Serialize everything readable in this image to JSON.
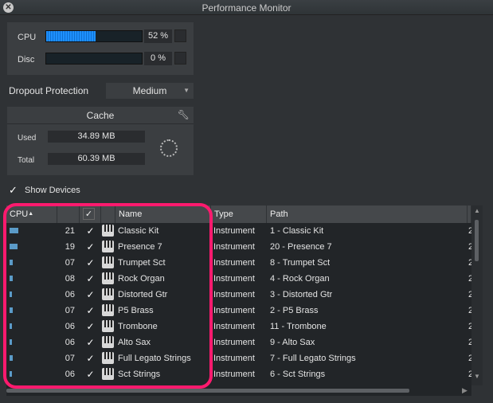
{
  "window": {
    "title": "Performance Monitor"
  },
  "meters": {
    "cpu_label": "CPU",
    "cpu_value": "52 %",
    "cpu_level": 0.52,
    "disc_label": "Disc",
    "disc_value": "0 %",
    "disc_level": 0
  },
  "dropout": {
    "label": "Dropout Protection",
    "value": "Medium"
  },
  "cache": {
    "title": "Cache",
    "used_label": "Used",
    "used_value": "34.89 MB",
    "total_label": "Total",
    "total_value": "60.39 MB"
  },
  "show_devices": {
    "label": "Show Devices",
    "checked": true
  },
  "table": {
    "headers": {
      "cpu": "CPU",
      "name": "Name",
      "type": "Type",
      "path": "Path"
    },
    "rows": [
      {
        "cpu": "21",
        "name": "Classic Kit",
        "type": "Instrument",
        "path": "1 - Classic Kit",
        "extra": "2"
      },
      {
        "cpu": "19",
        "name": "Presence 7",
        "type": "Instrument",
        "path": "20 - Presence 7",
        "extra": "2"
      },
      {
        "cpu": "07",
        "name": "Trumpet Sct",
        "type": "Instrument",
        "path": "8 - Trumpet Sct",
        "extra": "2"
      },
      {
        "cpu": "08",
        "name": "Rock Organ",
        "type": "Instrument",
        "path": "4 - Rock Organ",
        "extra": "2"
      },
      {
        "cpu": "06",
        "name": "Distorted Gtr",
        "type": "Instrument",
        "path": "3 - Distorted Gtr",
        "extra": "2"
      },
      {
        "cpu": "07",
        "name": "P5 Brass",
        "type": "Instrument",
        "path": "2 - P5 Brass",
        "extra": "2"
      },
      {
        "cpu": "06",
        "name": "Trombone",
        "type": "Instrument",
        "path": "11 - Trombone",
        "extra": "2"
      },
      {
        "cpu": "06",
        "name": "Alto Sax",
        "type": "Instrument",
        "path": "9 - Alto Sax",
        "extra": "2"
      },
      {
        "cpu": "07",
        "name": "Full Legato Strings",
        "type": "Instrument",
        "path": "7 - Full Legato Strings",
        "extra": "2"
      },
      {
        "cpu": "06",
        "name": "Sct Strings",
        "type": "Instrument",
        "path": "6 - Sct Strings",
        "extra": "2"
      }
    ]
  },
  "colors": {
    "meter_fill": "#1e90ff",
    "cpu_bar": "#5b9bc8",
    "highlight": "#ff1a6e"
  }
}
